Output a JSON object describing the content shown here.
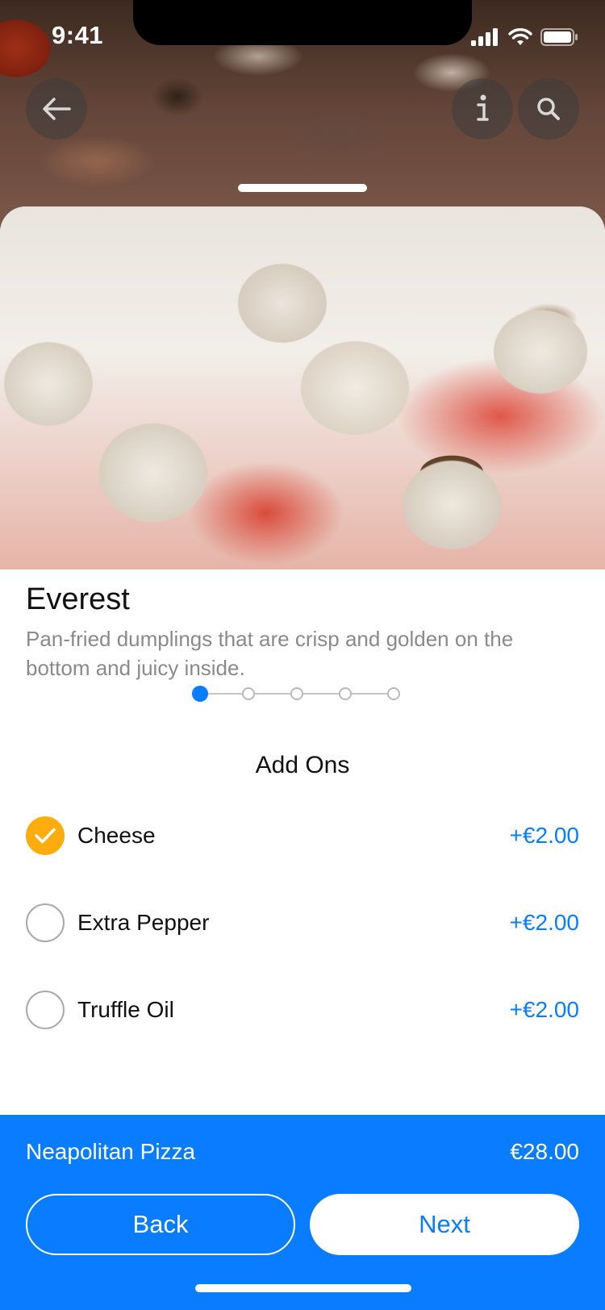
{
  "status_bar": {
    "time": "9:41"
  },
  "top_actions": {
    "back": "arrow-left-icon",
    "info": "info-icon",
    "search": "search-icon"
  },
  "dish": {
    "name": "Everest",
    "description": "Pan-fried dumplings that are crisp and golden on the bottom and juicy inside."
  },
  "stepper": {
    "total_steps": 5,
    "current_step": 1
  },
  "add_ons": {
    "title": "Add Ons",
    "items": [
      {
        "name": "Cheese",
        "price": "+€2.00",
        "checked": true
      },
      {
        "name": "Extra Pepper",
        "price": "+€2.00",
        "checked": false
      },
      {
        "name": "Truffle Oil",
        "price": "+€2.00",
        "checked": false
      }
    ]
  },
  "footer": {
    "item_name": "Neapolitan Pizza",
    "total": "€28.00",
    "back_label": "Back",
    "next_label": "Next"
  },
  "colors": {
    "accent": "#0a7cff",
    "check": "#ffad0d",
    "text": "#111111",
    "muted": "#8a8a8a"
  }
}
